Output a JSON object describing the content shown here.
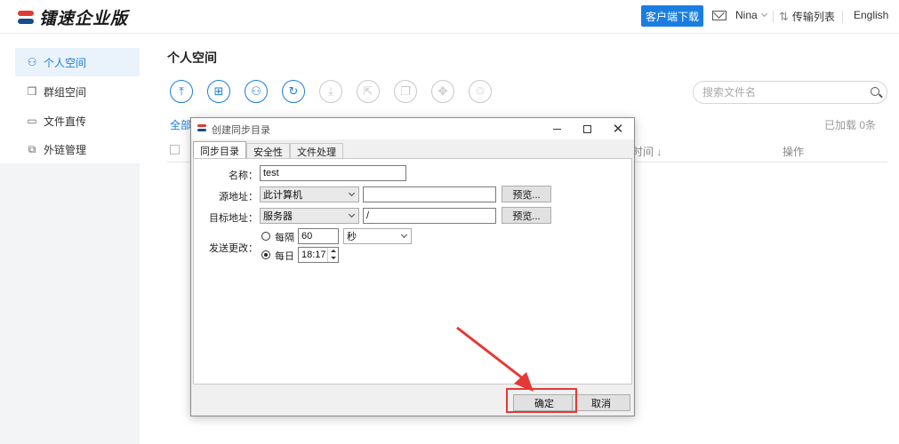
{
  "header": {
    "logo_text": "镭速企业版",
    "download_button": "客户端下载",
    "user_name": "Nina",
    "transfer_list": "传输列表",
    "language": "English",
    "icons": {
      "mail": "mail-icon",
      "transfer": "transfer-icon"
    }
  },
  "sidebar": {
    "items": [
      {
        "label": "个人空间",
        "icon": "person-icon",
        "active": true
      },
      {
        "label": "群组空间",
        "icon": "group-icon",
        "active": false
      },
      {
        "label": "文件直传",
        "icon": "monitor-icon",
        "active": false
      },
      {
        "label": "外链管理",
        "icon": "link-icon",
        "active": false
      }
    ]
  },
  "main": {
    "title": "个人空间",
    "toolbar_icons": [
      "upload-icon",
      "new-folder-icon",
      "share-user-icon",
      "sync-icon",
      "download-icon",
      "external-share-icon",
      "copy-icon",
      "move-icon",
      "delete-icon"
    ],
    "search_placeholder": "搜索文件名",
    "all_link": "全部",
    "loaded_count": "已加载 0条",
    "columns": {
      "time": "时间 ↓",
      "operation": "操作"
    }
  },
  "dialog": {
    "title": "创建同步目录",
    "tabs": [
      "同步目录",
      "安全性",
      "文件处理"
    ],
    "name_label": "名称：",
    "name_value": "test",
    "source_label": "源地址：",
    "source_type": "此计算机",
    "source_path": "",
    "target_label": "目标地址：",
    "target_type": "服务器",
    "target_path": "/",
    "browse_label": "预览...",
    "send_change_label": "发送更改：",
    "every_label": "每隔",
    "every_value": "60",
    "unit_value": "秒",
    "daily_label": "每日",
    "daily_time": "18:17",
    "ok_label": "确定",
    "cancel_label": "取消"
  },
  "colors": {
    "accent": "#1a7ee0",
    "highlight": "#e53935"
  }
}
